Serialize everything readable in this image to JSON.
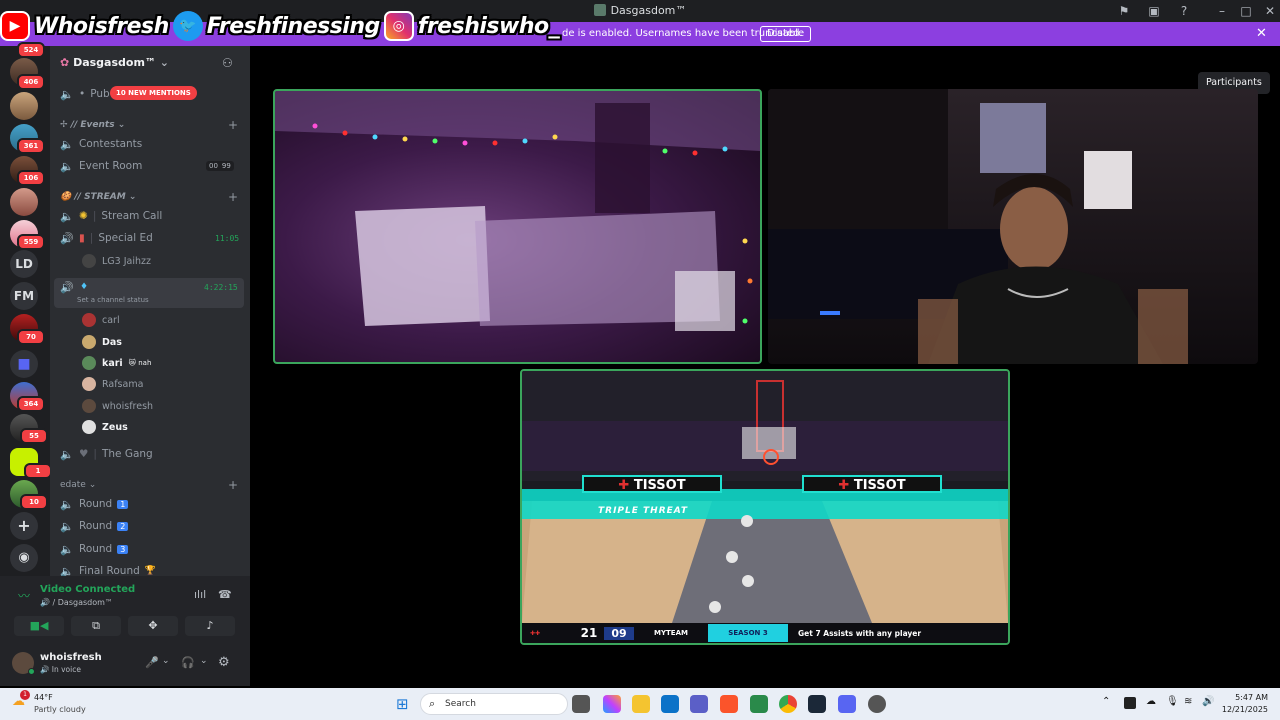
{
  "window": {
    "title": "Dasgasdom™"
  },
  "overlay": {
    "youtube": "Whoisfresh",
    "twitter": "Freshfinessing",
    "instagram": "freshiswho_"
  },
  "notice": {
    "message": "de is enabled. Usernames have been truncated.",
    "disable_label": "Disable"
  },
  "rail": {
    "badges": [
      "524",
      "406",
      "361",
      "106",
      "559",
      "70",
      "364",
      "55",
      "1",
      "10"
    ],
    "text_servers": [
      "LD",
      "FM"
    ]
  },
  "sidebar": {
    "server_name": "Dasgasdom™",
    "mentions_label": "10 NEW MENTIONS",
    "pub_channel": "Pub",
    "events_category": "// Events",
    "contestants": "Contestants",
    "event_room": "Event Room",
    "event_room_count_a": "00",
    "event_room_count_b": "99",
    "stream_category": "// STREAM",
    "stream_call": "Stream Call",
    "special_ed": "Special Ed",
    "special_ed_time": "11:05",
    "lg3_user": "LG3 Jaihzz",
    "active_time": "4:22:15",
    "set_status": "Set a channel status",
    "users": [
      {
        "name": "carl"
      },
      {
        "name": "Das"
      },
      {
        "name": "kari",
        "tag": "nah"
      },
      {
        "name": "Rafsama"
      },
      {
        "name": "whoisfresh"
      },
      {
        "name": "Zeus"
      }
    ],
    "the_gang": "The Gang",
    "edate_category": "edate",
    "rounds": [
      "Round",
      "Round",
      "Round",
      "Final Round"
    ],
    "round_badges": [
      "1",
      "2",
      "3",
      "🏆"
    ]
  },
  "voice": {
    "status": "Video Connected",
    "server": "/ Dasgasdom™",
    "username": "whoisfresh",
    "user_status": "In voice"
  },
  "main": {
    "participants_label": "Participants",
    "game": {
      "sponsor": "TISSOT",
      "mode": "TRIPLE THREAT",
      "score": "21",
      "clock": "09",
      "team": "MYTEAM",
      "season": "SEASON 3",
      "objective": "Get 7 Assists with any player"
    }
  },
  "taskbar": {
    "weather_temp": "44°F",
    "weather_desc": "Partly cloudy",
    "search_placeholder": "Search",
    "time": "5:47 AM",
    "date": "12/21/2025",
    "notif_count": "1"
  }
}
